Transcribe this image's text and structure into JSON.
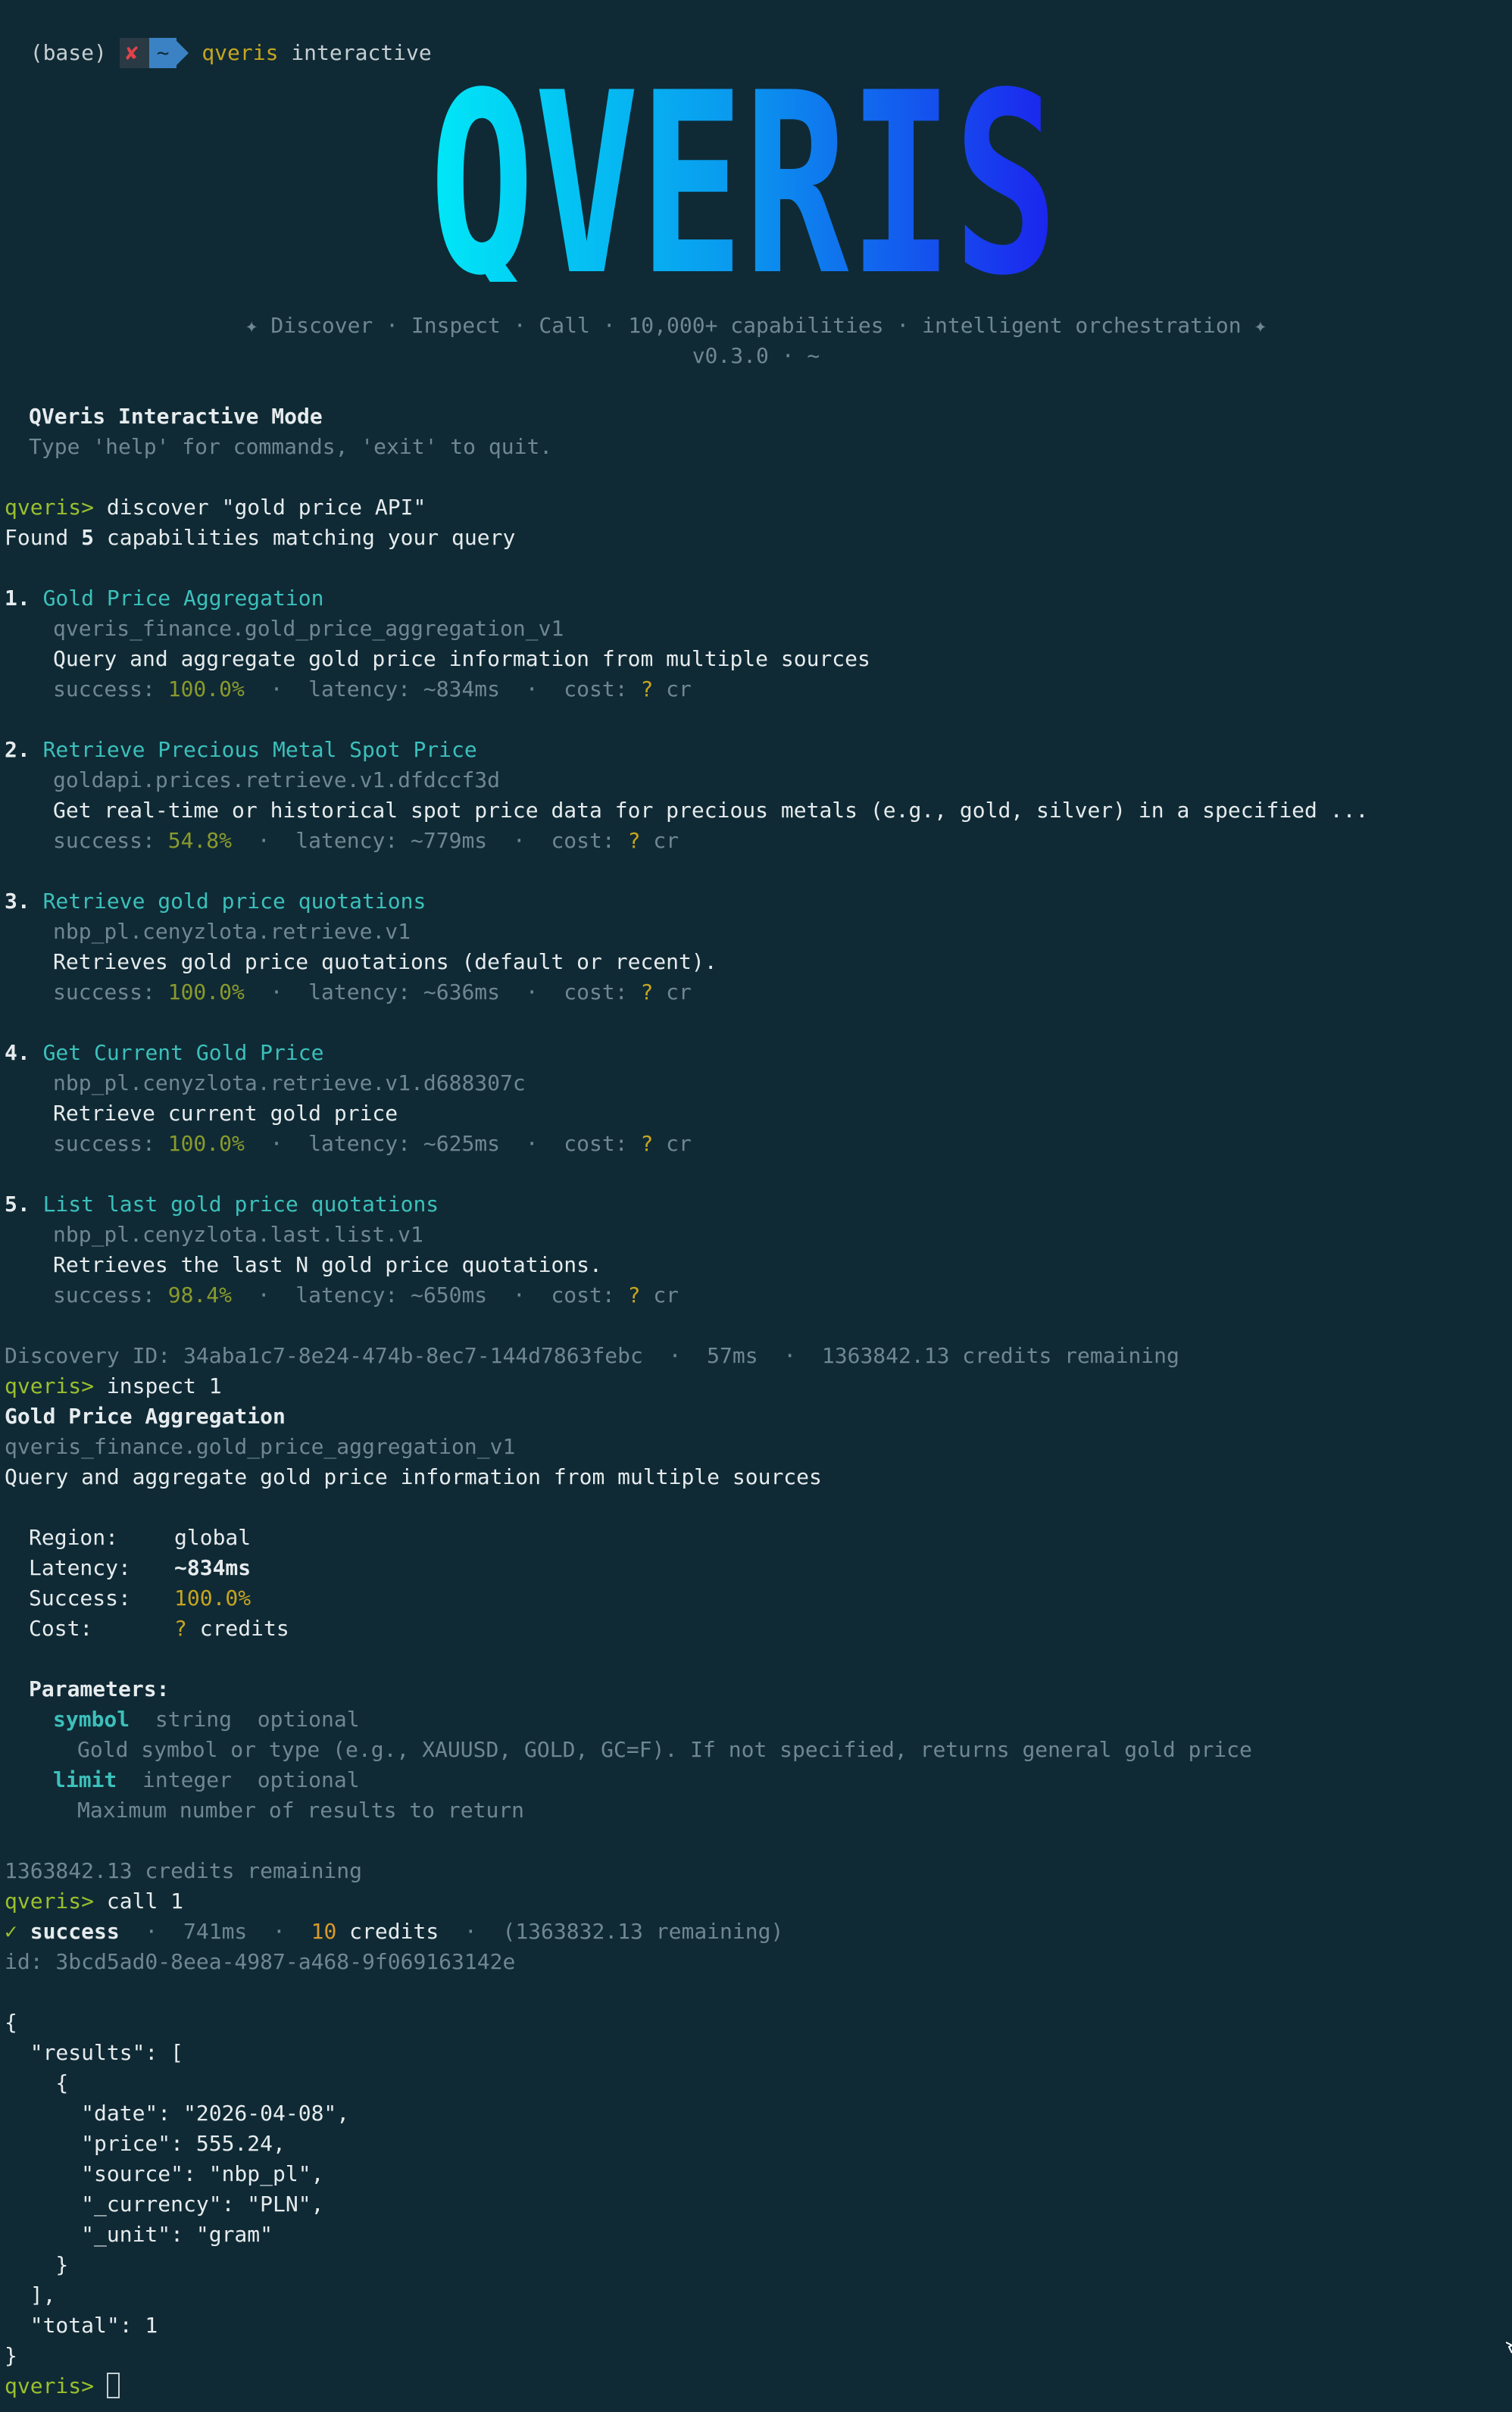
{
  "shell": {
    "env": "(base)",
    "x_mark": "✘",
    "dir": "~",
    "command_keyword": "qveris",
    "command_rest": " interactive"
  },
  "banner": {
    "logo_text": "QVERIS",
    "tagline": "✦ Discover · Inspect · Call · 10,000+ capabilities · intelligent orchestration ✦",
    "version": "v0.3.0 · ~"
  },
  "intro": {
    "title": "QVeris Interactive Mode",
    "hint": "Type 'help' for commands, 'exit' to quit."
  },
  "prompt": "qveris>",
  "discover": {
    "command": " discover \"gold price API\"",
    "found_prefix": "Found ",
    "found_count": "5",
    "found_suffix": " capabilities matching your query",
    "results": [
      {
        "num": "1.",
        "name": "Gold Price Aggregation",
        "id": "qveris_finance.gold_price_aggregation_v1",
        "desc": "Query and aggregate gold price information from multiple sources",
        "success_label": "success: ",
        "success": "100.0%",
        "latency_label": "  ·  latency: ~834ms  ·  cost: ",
        "cost": "?",
        "cost_unit": " cr"
      },
      {
        "num": "2.",
        "name": "Retrieve Precious Metal Spot Price",
        "id": "goldapi.prices.retrieve.v1.dfdccf3d",
        "desc": "Get real-time or historical spot price data for precious metals (e.g., gold, silver) in a specified ...",
        "success_label": "success: ",
        "success": "54.8%",
        "latency_label": "  ·  latency: ~779ms  ·  cost: ",
        "cost": "?",
        "cost_unit": " cr"
      },
      {
        "num": "3.",
        "name": "Retrieve gold price quotations",
        "id": "nbp_pl.cenyzlota.retrieve.v1",
        "desc": "Retrieves gold price quotations (default or recent).",
        "success_label": "success: ",
        "success": "100.0%",
        "latency_label": "  ·  latency: ~636ms  ·  cost: ",
        "cost": "?",
        "cost_unit": " cr"
      },
      {
        "num": "4.",
        "name": "Get Current Gold Price",
        "id": "nbp_pl.cenyzlota.retrieve.v1.d688307c",
        "desc": "Retrieve current gold price",
        "success_label": "success: ",
        "success": "100.0%",
        "latency_label": "  ·  latency: ~625ms  ·  cost: ",
        "cost": "?",
        "cost_unit": " cr"
      },
      {
        "num": "5.",
        "name": "List last gold price quotations",
        "id": "nbp_pl.cenyzlota.last.list.v1",
        "desc": "Retrieves the last N gold price quotations.",
        "success_label": "success: ",
        "success": "98.4%",
        "latency_label": "  ·  latency: ~650ms  ·  cost: ",
        "cost": "?",
        "cost_unit": " cr"
      }
    ],
    "footer": "Discovery ID: 34aba1c7-8e24-474b-8ec7-144d7863febc  ·  57ms  ·  1363842.13 credits remaining"
  },
  "inspect": {
    "command": " inspect 1",
    "name": "Gold Price Aggregation",
    "id": "qveris_finance.gold_price_aggregation_v1",
    "desc": "Query and aggregate gold price information from multiple sources",
    "region_label": "Region:",
    "region": "global",
    "latency_label": "Latency:",
    "latency": "~834ms",
    "success_label": "Success:",
    "success": "100.0%",
    "cost_label": "Cost:",
    "cost": "?",
    "cost_unit": " credits",
    "params_label": "Parameters:",
    "params": [
      {
        "name": "symbol",
        "meta": "  string  optional",
        "desc": "Gold symbol or type (e.g., XAUUSD, GOLD, GC=F). If not specified, returns general gold price"
      },
      {
        "name": "limit",
        "meta": "  integer  optional",
        "desc": "Maximum number of results to return"
      }
    ],
    "footer": "1363842.13 credits remaining"
  },
  "call": {
    "command": " call 1",
    "check": "✓",
    "status": " success",
    "time": "  ·  741ms  ·  ",
    "credits_num": "10",
    "credits_word": " credits",
    "remaining": "  ·  (1363832.13 remaining)",
    "id": "id: 3bcd5ad0-8eea-4987-a468-9f069163142e",
    "json_lines": [
      "{",
      "  \"results\": [",
      "    {",
      "      \"date\": \"2026-04-08\",",
      "      \"price\": 555.24,",
      "      \"source\": \"nbp_pl\",",
      "      \"_currency\": \"PLN\",",
      "      \"_unit\": \"gram\"",
      "    }",
      "  ],",
      "  \"total\": 1",
      "}"
    ]
  },
  "colors": {
    "background": "#0f2a35",
    "prompt": "#9bbf2e",
    "accent_teal": "#3cc0bb",
    "logo_gradient_start": "#00e5f5",
    "logo_gradient_end": "#1a2ef0"
  }
}
